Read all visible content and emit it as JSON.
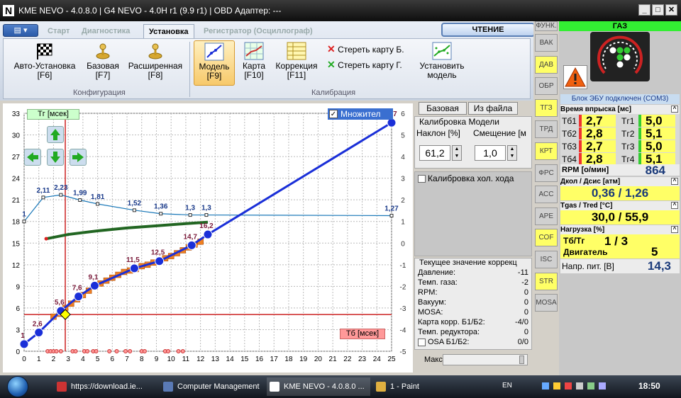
{
  "window": {
    "title": "KME NEVO - 4.0.8.0  |  G4 NEVO - 4.0H r1 (9.9 r1)  |  OBD Адаптер: ---",
    "logo": "N",
    "controls": {
      "minimize": "_",
      "maximize": "□",
      "close": "✕"
    }
  },
  "ribbon": {
    "menu_label": "▤ ▾",
    "tabs": [
      {
        "label": "Старт"
      },
      {
        "label": "Диагностика"
      },
      {
        "label": "Установка"
      },
      {
        "label": "Регистратор (Осциллограф)"
      }
    ],
    "read_button": "ЧТЕНИЕ",
    "buttons": [
      {
        "line1": "Авто-Установка",
        "line2": "[F6]",
        "icon": "checkered-flag-icon"
      },
      {
        "line1": "Базовая",
        "line2": "[F7]",
        "icon": "joystick-icon"
      },
      {
        "line1": "Расширенная",
        "line2": "[F8]",
        "icon": "joystick-icon"
      },
      {
        "line1": "Модель",
        "line2": "[F9]",
        "icon": "model-graph-icon"
      },
      {
        "line1": "Карта",
        "line2": "[F10]",
        "icon": "map-grid-icon"
      },
      {
        "line1": "Коррекция",
        "line2": "[F11]",
        "icon": "table-icon"
      },
      {
        "line1": "Установить",
        "line2": "модель",
        "icon": "set-model-icon"
      }
    ],
    "erase_b": "Стереть карту Б.",
    "erase_g": "Стереть карту Г.",
    "group_config": "Конфигурация",
    "group_calib": "Калибрация"
  },
  "sidebar": [
    "ФУНК.",
    "ВАК",
    "ДАВ",
    "ОБР",
    "ТГЗ",
    "ТРД",
    "КРТ",
    "ФРС",
    "АСС",
    "АРЕ",
    "СОF",
    "ISC",
    "STR",
    "МОSA"
  ],
  "sidebar_yellow": [
    "ДАВ",
    "ТГЗ",
    "КРТ",
    "СОF",
    "STR"
  ],
  "gas": {
    "header": "ГАЗ",
    "ecu_status": "Блок ЭБУ подключен (COM3)",
    "injection_title": "Время впрыска [мс]",
    "tb": [
      {
        "label": "Тб1",
        "value": "2,7"
      },
      {
        "label": "Тб2",
        "value": "2,8"
      },
      {
        "label": "Тб3",
        "value": "2,7"
      },
      {
        "label": "Тб4",
        "value": "2,8"
      }
    ],
    "tg": [
      {
        "label": "Тг1",
        "value": "5,0"
      },
      {
        "label": "Тг2",
        "value": "5,1"
      },
      {
        "label": "Тг3",
        "value": "5,0"
      },
      {
        "label": "Тг4",
        "value": "5,1"
      }
    ],
    "rpm_label": "RPM [о/мин]",
    "rpm_value": "864",
    "pressure_title": "Дкол / Дсис [атм]",
    "pressure_value": "0,36  /  1,26",
    "temp_title": "Tgas / Tred [°C]",
    "temp_value": "30,0  /  55,9",
    "load_title": "Нагрузка [%]",
    "tb_tg_label": "Тб/Тг",
    "tb_tg_value": "1   /   3",
    "engine_label": "Двигатель",
    "engine_value": "5",
    "voltage_label": "Напр. пит. [В]",
    "voltage_value": "14,3"
  },
  "right_panel": {
    "btn_base": "Базовая",
    "btn_file": "Из файла",
    "calib_title": "Калибровка Модели",
    "slope_label": "Наклон [%]",
    "offset_label": "Смещение [м",
    "slope_value": "61,2",
    "offset_value": "1,0",
    "idle_calib": "Калибровка хол. хода",
    "current_title": "Текущее значение коррекц",
    "rows": [
      {
        "k": "Давление:",
        "v": "-11"
      },
      {
        "k": "Темп. газа:",
        "v": "-2"
      },
      {
        "k": "RPM:",
        "v": "0"
      },
      {
        "k": "Вакуум:",
        "v": "0"
      },
      {
        "k": "MOSA:",
        "v": "0"
      },
      {
        "k": "Карта корр. Б1/Б2:",
        "v": "-4/0"
      },
      {
        "k": "Темп. редуктора:",
        "v": "0"
      },
      {
        "k": "OSA Б1/Б2:",
        "v": "0/0"
      }
    ],
    "max_label": "Макс"
  },
  "taskbar": {
    "tasks": [
      {
        "label": "https://download.ie...",
        "color": "#cc3333"
      },
      {
        "label": "Computer Management",
        "color": "#5a7ab5"
      },
      {
        "label": "KME NEVO - 4.0.8.0 ...",
        "color": "#ffffff"
      },
      {
        "label": "1 - Paint",
        "color": "#e0b040"
      }
    ],
    "lang": "EN",
    "clock": "18:50"
  },
  "chart_data": {
    "type": "line",
    "ylabel_tag": "Тг [мсек]",
    "xlabel_tag": "Тб [мсек]",
    "multiplier_label": "Множител",
    "xlim": [
      0,
      25
    ],
    "ylim": [
      0,
      33
    ],
    "x_ticks": [
      0,
      1,
      2,
      3,
      4,
      5,
      6,
      7,
      8,
      9,
      10,
      11,
      12,
      13,
      14,
      15,
      16,
      17,
      18,
      19,
      20,
      21,
      22,
      23,
      24,
      25
    ],
    "y_ticks": [
      0,
      3,
      6,
      9,
      12,
      15,
      18,
      21,
      24,
      27,
      30,
      33
    ],
    "y2lim": [
      -5,
      6
    ],
    "y2_ticks": [
      -5,
      -4,
      -3,
      -2,
      -1,
      0,
      1,
      2,
      3,
      4,
      5,
      6
    ],
    "cursor": {
      "x": 2.8,
      "y": 5.1
    },
    "series": [
      {
        "name": "Модель",
        "color": "#1a2fd8",
        "points": [
          [
            0,
            1
          ],
          [
            1,
            2.6
          ],
          [
            2.5,
            5.6
          ],
          [
            3.7,
            7.6
          ],
          [
            4.8,
            9.1
          ],
          [
            7.5,
            11.5
          ],
          [
            9.2,
            12.5
          ],
          [
            11.4,
            14.7
          ],
          [
            12.5,
            16.2
          ],
          [
            25,
            31.7
          ]
        ],
        "labels": [
          "1",
          "2,6",
          "5,6",
          "7,6",
          "9,1",
          "11,5",
          "12,5",
          "14,7",
          "16,2",
          "31,7"
        ]
      },
      {
        "name": "Множитель",
        "color": "#1a78b8",
        "points": [
          [
            0,
            1
          ],
          [
            1.3,
            2.11
          ],
          [
            2.5,
            2.23
          ],
          [
            3.8,
            1.99
          ],
          [
            5,
            1.81
          ],
          [
            7.5,
            1.52
          ],
          [
            9.3,
            1.36
          ],
          [
            11.3,
            1.3
          ],
          [
            12.4,
            1.3
          ],
          [
            25,
            1.27
          ]
        ],
        "labels": [
          "1",
          "2,11",
          "2,23",
          "1,99",
          "1,81",
          "1,52",
          "1,36",
          "1,3",
          "1,3",
          "1,27"
        ]
      },
      {
        "name": "Коррекция",
        "color": "#226622",
        "points": [
          [
            1.5,
            15.6
          ],
          [
            3,
            16.2
          ],
          [
            5,
            16.7
          ],
          [
            7,
            17.1
          ],
          [
            9,
            17.4
          ],
          [
            11,
            17.7
          ],
          [
            12.5,
            17.9
          ]
        ]
      }
    ],
    "orange_bars": [
      [
        2,
        4.8
      ],
      [
        2.4,
        5.2
      ],
      [
        2.8,
        6.0
      ],
      [
        3.2,
        6.6
      ],
      [
        3.6,
        7.2
      ],
      [
        4,
        7.8
      ],
      [
        4.4,
        8.4
      ],
      [
        4.8,
        9.0
      ],
      [
        5.2,
        9.4
      ],
      [
        5.6,
        9.8
      ],
      [
        6,
        10.2
      ],
      [
        6.4,
        10.6
      ],
      [
        6.8,
        11.0
      ],
      [
        7.2,
        11.2
      ],
      [
        7.6,
        11.4
      ],
      [
        8,
        11.8
      ],
      [
        8.4,
        12.0
      ],
      [
        8.8,
        12.3
      ],
      [
        9.2,
        12.6
      ],
      [
        9.6,
        12.9
      ],
      [
        10,
        13.2
      ],
      [
        10.4,
        13.6
      ],
      [
        10.8,
        14.0
      ],
      [
        11.2,
        14.4
      ],
      [
        11.6,
        14.8
      ],
      [
        12,
        15.2
      ]
    ],
    "red_dots": [
      1.6,
      1.8,
      2.0,
      2.2,
      2.5,
      3.3,
      3.5,
      4.1,
      4.3,
      4.7,
      4.9,
      5.8,
      6.3,
      6.9,
      7.2,
      8.0,
      8.2,
      9.6,
      9.8,
      10.5,
      10.8
    ]
  }
}
